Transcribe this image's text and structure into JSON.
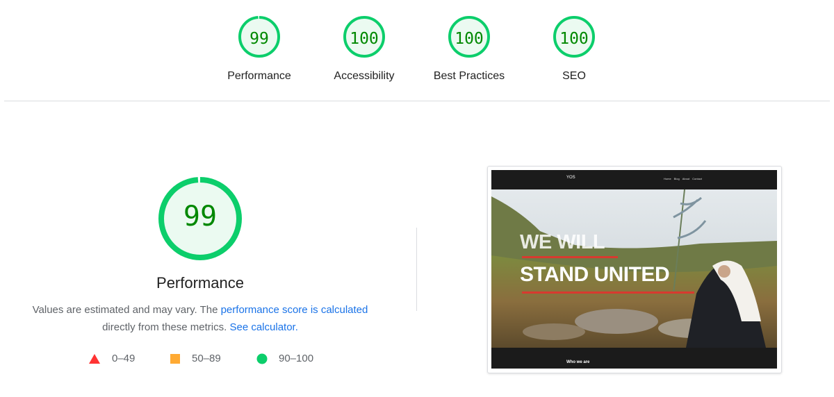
{
  "categories": [
    {
      "name": "Performance",
      "score": "99",
      "fraction": 0.99
    },
    {
      "name": "Accessibility",
      "score": "100",
      "fraction": 1.0
    },
    {
      "name": "Best Practices",
      "score": "100",
      "fraction": 1.0
    },
    {
      "name": "SEO",
      "score": "100",
      "fraction": 1.0
    }
  ],
  "main": {
    "score": "99",
    "fraction": 0.99,
    "title": "Performance",
    "desc_prefix": "Values are estimated and may vary. The ",
    "desc_link1": "performance score is calculated",
    "desc_middle": " directly from these metrics. ",
    "desc_link2": "See calculator.",
    "desc_suffix": ""
  },
  "legend": [
    {
      "shape": "triangle",
      "range": "0–49",
      "color": "#ff3333"
    },
    {
      "shape": "square",
      "range": "50–89",
      "color": "#ffaa33"
    },
    {
      "shape": "circle",
      "range": "90–100",
      "color": "#0cce6b"
    }
  ],
  "screenshot": {
    "brand": "YOS",
    "nav": [
      "Home",
      "Blog",
      "About",
      "Contact"
    ],
    "hero_line1": "WE WILL",
    "hero_line2": "STAND UNITED",
    "footer_text": "Who we are"
  },
  "colors": {
    "pass_ring": "#0cce6b",
    "pass_fill": "#ebfaf1",
    "pass_text": "#008800",
    "link": "#1a73e8"
  }
}
